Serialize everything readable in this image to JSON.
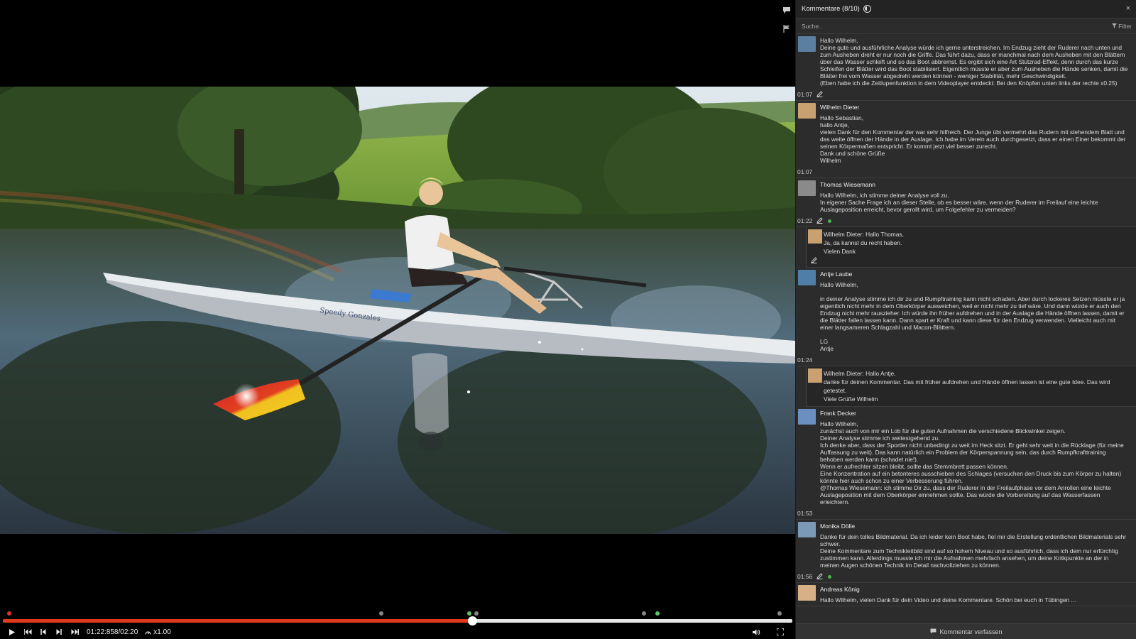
{
  "video": {
    "timestamp": "01:22:858/02:20",
    "speed": "x1.00",
    "progress": 0.594,
    "boat_text": "Speedy Gonzales",
    "markers": [
      {
        "pos": 0.008,
        "color": "red"
      },
      {
        "pos": 0.479,
        "color": "grey"
      },
      {
        "pos": 0.591,
        "color": "green"
      },
      {
        "pos": 0.6,
        "color": "grey"
      },
      {
        "pos": 0.812,
        "color": "grey"
      },
      {
        "pos": 0.829,
        "color": "green"
      },
      {
        "pos": 0.984,
        "color": "grey"
      }
    ]
  },
  "panel": {
    "title": "Kommentare (8/10)",
    "search_placeholder": "Suche..",
    "filter_label": "Filter",
    "close_label": "×",
    "compose_label": "Kommentar verfassen"
  },
  "comments": [
    {
      "author": "",
      "avatar_color": "#5a7fa0",
      "body": "Hallo Wilhelm,\nDeine gute und ausführliche Analyse würde ich gerne unterstreichen. Im Endzug zieht der Ruderer nach unten und zum Ausheben dreht er nur noch die Griffe. Das führt dazu, dass er manchmal nach dem Ausheben mit den Blättern über das Wasser schleift und so das Boot abbremst. Es ergibt sich eine Art Stützrad-Effekt, denn durch das kurze Schleifen der Blätter wird das Boot stabilisiert. Eigentlich müsste er aber zum Ausheben die Hände senken, damit die Blätter frei vom Wasser abgedreht werden können - weniger Stabilität, mehr Geschwindigkeit.\n(Eben habe ich die Zeitlupenfunktion in dem Videoplayer entdeckt: Bei den Knöpfen unten links der rechte x0.25)",
      "time": "01:07",
      "edit": true,
      "green": false
    },
    {
      "author": "Wilhelm Dieter",
      "avatar_color": "#c9a070",
      "body": "Hallo Sebastian,\nhallo Antje,\nvielen Dank für den Kommentar der war sehr hilfreich. Der Junge übt vermehrt das Rudern mit stehendem Blatt und das weite öffnen der Hände in der Auslage. Ich habe im Verein auch durchgesetzt, dass er einen Einer bekommt der seinen Körpermaßen entspricht. Er kommt jetzt viel besser zurecht.\nDank und schöne Grüße\nWilhelm",
      "time": "01:07",
      "edit": false,
      "green": false
    },
    {
      "author": "Thomas Wiesemann",
      "avatar_color": "#8a8a8a",
      "body": "Hallo Wilhelm, ich stimme deiner Analyse voll zu.\nIn eigener Sache Frage ich an dieser Stelle, ob es besser wäre, wenn der Ruderer im Freilauf eine leichte Auslageposition erreicht, bevor gerollt wird, um Folgefehler zu vermeiden?",
      "time": "01:22",
      "edit": true,
      "green": true,
      "reply": {
        "avatar_color": "#c9a070",
        "body": "Wilhelm Dieter: Hallo Thomas,\nJa, da kannst du recht haben.\nVielen Dank",
        "edit": true
      }
    },
    {
      "author": "Antje Laube",
      "avatar_color": "#4f7fa8",
      "body": "Hallo Wilhelm,\n\nin deiner Analyse stimme ich dir zu und Rumpftraining kann nicht schaden. Aber durch lockeres Setzen müsste er ja eigentlich nicht mehr in dem Oberkörper ausweichen, weil er nicht mehr zu tief wäre. Und dann würde er auch den Endzug nicht mehr rauszieher. Ich würde ihn früher aufdrehen und in der Auslage die Hände öffnen lassen, damit er die Blätter fallen lassen kann. Dann spart er Kraft und kann diese für den Endzug verwenden. Vielleicht auch mit einer langsameren Schlagzahl und Macon-Blättern.\n\nLG\nAntje",
      "time": "01:24",
      "edit": false,
      "green": false,
      "reply": {
        "avatar_color": "#c9a070",
        "body": "Wilhelm Dieter: Hallo Antje,\ndanke für deinen Kommentar. Das mit früher aufdrehen und Hände öffnen lassen ist eine gute Idee. Das wird getestet.\nViele Grüße Wilhelm",
        "edit": false
      }
    },
    {
      "author": "Frank Decker",
      "avatar_color": "#6a8fc0",
      "body": "Hallo Wilhelm,\nzunächst auch von mir ein Lob für die guten Aufnahmen die verschiedene Blickwinkel zeigen.\nDeiner Analyse stimme ich weitestgehend zu.\nIch denke aber, dass der Sportler nicht unbedingt zu weit im Heck sitzt. Er geht sehr weit in die Rücklage (für meine Auffassung zu weit). Das kann natürlich ein Problem der Körperspannung sein, das durch Rumpfkrafttraining behoben werden kann (schadet nie!).\nWenn er aufrechter sitzen bleibt, sollte das Stemmbrett passen können.\nEine Konzentration auf ein betonteres ausschieben des Schlages (versuchen den Druck bis zum Körper zu halten) könnte hier auch schon zu einer Verbesserung führen.\n@Thomas Wiesemann: ich stimme Dir zu, dass der Ruderer in der Freilaufphase vor dem Anrollen eine leichte Auslageposition mit dem Oberkörper einnehmen sollte. Das würde die Vorbereitung auf das Wasserfassen erleichtern.",
      "time": "01:53",
      "edit": false,
      "green": false
    },
    {
      "author": "Monika Dölle",
      "avatar_color": "#7a9ab8",
      "body": "Danke für dein tolles Bildmaterial. Da ich leider kein Boot habe, fiel mir die Erstellung ordentlichen Bildmaterials sehr schwer.\nDeine Kommentare zum Technikleitbild sind auf so hohem Niveau und so ausführlich, dass ich dem nur erfürchtig zustimmen kann. Allerdings musste ich mir die Aufnahmen mehrfach ansehen, um deine Kritkpunkte an der in meinen Augen schönen Technik im Detail nachvollziehen zu können.",
      "time": "01:56",
      "edit": true,
      "green": true
    },
    {
      "author": "Andreas König",
      "avatar_color": "#d8b088",
      "body": "Hallo Wilhelm, vielen Dank für dein Video und deine Kommentare. Schön bei euch in Tübingen ...",
      "time": "",
      "edit": false,
      "green": false
    }
  ]
}
